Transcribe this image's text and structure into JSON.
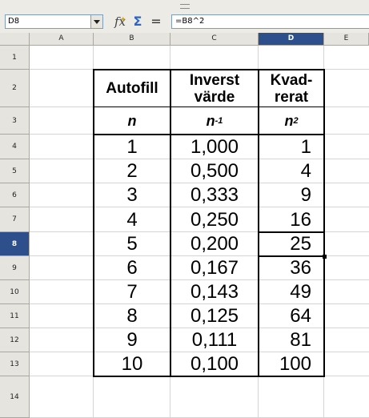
{
  "formula_bar": {
    "cell_reference": "D8",
    "formula": "=B8^2",
    "icons": [
      "function-wizard-icon",
      "sum-icon",
      "equals-icon"
    ]
  },
  "columns": [
    "A",
    "B",
    "C",
    "D",
    "E"
  ],
  "active_column": "D",
  "rows": [
    "1",
    "2",
    "3",
    "4",
    "5",
    "6",
    "7",
    "8",
    "9",
    "10",
    "11",
    "12",
    "13",
    "14"
  ],
  "active_row": "8",
  "table": {
    "headers": {
      "b": "Autofill",
      "c_line1": "Inverst",
      "c_line2": "värde",
      "d_line1": "Kvad-",
      "d_line2": "rerat"
    },
    "subheaders": {
      "b": "n",
      "c_base": "n",
      "c_sup": "-1",
      "d_base": "n",
      "d_sup": "2"
    },
    "data": [
      {
        "n": "1",
        "inverse": "1,000",
        "square": "1"
      },
      {
        "n": "2",
        "inverse": "0,500",
        "square": "4"
      },
      {
        "n": "3",
        "inverse": "0,333",
        "square": "9"
      },
      {
        "n": "4",
        "inverse": "0,250",
        "square": "16"
      },
      {
        "n": "5",
        "inverse": "0,200",
        "square": "25"
      },
      {
        "n": "6",
        "inverse": "0,167",
        "square": "36"
      },
      {
        "n": "7",
        "inverse": "0,143",
        "square": "49"
      },
      {
        "n": "8",
        "inverse": "0,125",
        "square": "64"
      },
      {
        "n": "9",
        "inverse": "0,111",
        "square": "81"
      },
      {
        "n": "10",
        "inverse": "0,100",
        "square": "100"
      }
    ]
  },
  "colors": {
    "header_bg": "#e6e4de",
    "active_header_bg": "#2d4f8c",
    "toolbar_bg": "#ecebe6"
  }
}
